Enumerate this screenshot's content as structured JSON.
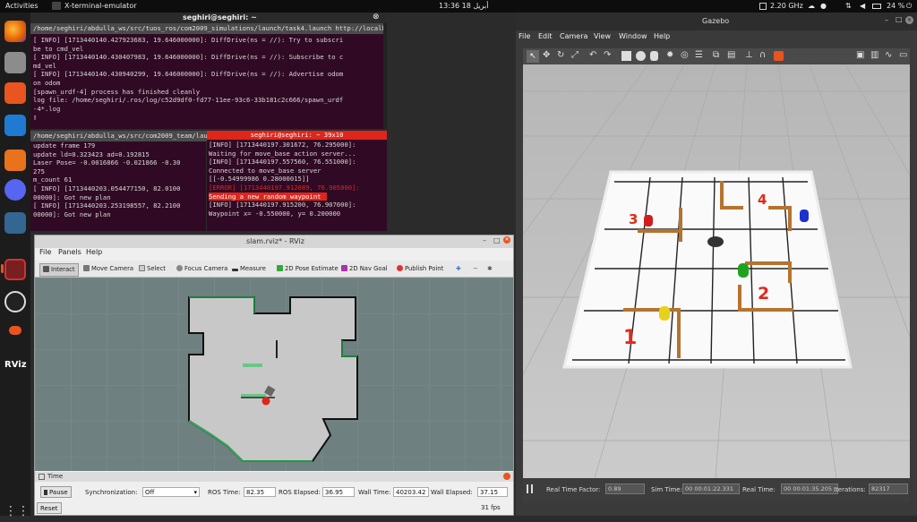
{
  "topbar": {
    "activities": "Activities",
    "app_name": "X-terminal-emulator",
    "clock": "13:36  أبريل 18",
    "cpu": "2.20 GHz",
    "battery": "24 %"
  },
  "terminal_top": {
    "title": "seghiri@seghiri: ~",
    "tab": "/home/seghiri/abdulla_ws/src/tuos_ros/com2009_simulations/launch/task4.launch http://localhost:11311",
    "lines": [
      "[ INFO] [1713440140.427923683, 19.646000000]: DiffDrive(ns = //): Try to subscri",
      "be to cmd_vel",
      "[ INFO] [1713440140.430407983, 19.646000000]: DiffDrive(ns = //): Subscribe to c",
      "md_vel",
      "[ INFO] [1713440140.430940299, 19.646000000]: DiffDrive(ns = //): Advertise odom",
      " on odom",
      "[spawn_urdf-4] process has finished cleanly",
      "log file: /home/seghiri/.ros/log/c52d9df0-fd77-11ee-93c6-33b181c2c666/spawn_urdf",
      "-4*.log",
      "▯"
    ]
  },
  "terminal_left": {
    "tab": "/home/seghiri/abdulla_ws/src/com2009_team/laun",
    "lines": [
      "update frame 179",
      "update ld=0.323423 ad=0.192815",
      "Laser Pose= -0.0016866 -0.021866 -0.30",
      "275",
      "m_count 61",
      "[ INFO] [1713440203.054477150, 82.0100",
      "00000]: Got new plan",
      "[ INFO] [1713440203.253198557, 82.2100",
      "00000]: Got new plan"
    ]
  },
  "terminal_right": {
    "title": "seghiri@seghiri: ~ 39x10",
    "lines": [
      "[INFO] [1713440197.301672, 76.295000]:",
      "Waiting for move_base action server...",
      "[INFO] [1713440197.557560, 76.551000]:",
      "Connected to move_base server",
      "[[-0.54999986  0.28000015]]",
      "[ERROR] [1713440197.912089, 76.905000]:",
      "Sending a new random waypoint",
      "[INFO] [1713440197.915200, 76.907000]:",
      "Waypoint x= -0.550000, y= 0.200000"
    ]
  },
  "rviz": {
    "title": "slam.rviz* - RViz",
    "menu": [
      "File",
      "Panels",
      "Help"
    ],
    "tools": [
      "Interact",
      "Move Camera",
      "Select",
      "Focus Camera",
      "Measure",
      "2D Pose Estimate",
      "2D Nav Goal",
      "Publish Point"
    ],
    "time_panel_title": "Time",
    "pause": "Pause",
    "sync_label": "Synchronization:",
    "sync_value": "Off",
    "ros_time_label": "ROS Time:",
    "ros_time": "82.35",
    "ros_elapsed_label": "ROS Elapsed:",
    "ros_elapsed": "36.95",
    "wall_time_label": "Wall Time:",
    "wall_time": "40203.42",
    "wall_elapsed_label": "Wall Elapsed:",
    "wall_elapsed": "37.15",
    "reset": "Reset",
    "fps": "31 fps"
  },
  "gazebo": {
    "title": "Gazebo",
    "menu": [
      "File",
      "Edit",
      "Camera",
      "View",
      "Window",
      "Help"
    ],
    "zone_labels": [
      "1",
      "2",
      "3",
      "4"
    ],
    "status": {
      "rtf_label": "Real Time Factor:",
      "rtf": "0.89",
      "sim_label": "Sim Time:",
      "sim": "00 00:01:22.331",
      "real_label": "Real Time:",
      "real": "00 00:01:35.205",
      "iter_label": "Iterations:",
      "iter": "82317"
    }
  },
  "colors": {
    "terminal_bg": "#300a24",
    "error_red": "#e0251b",
    "accent_orange": "#e95420",
    "map_free": "#c8c8c8",
    "map_bg": "#6f8080"
  }
}
